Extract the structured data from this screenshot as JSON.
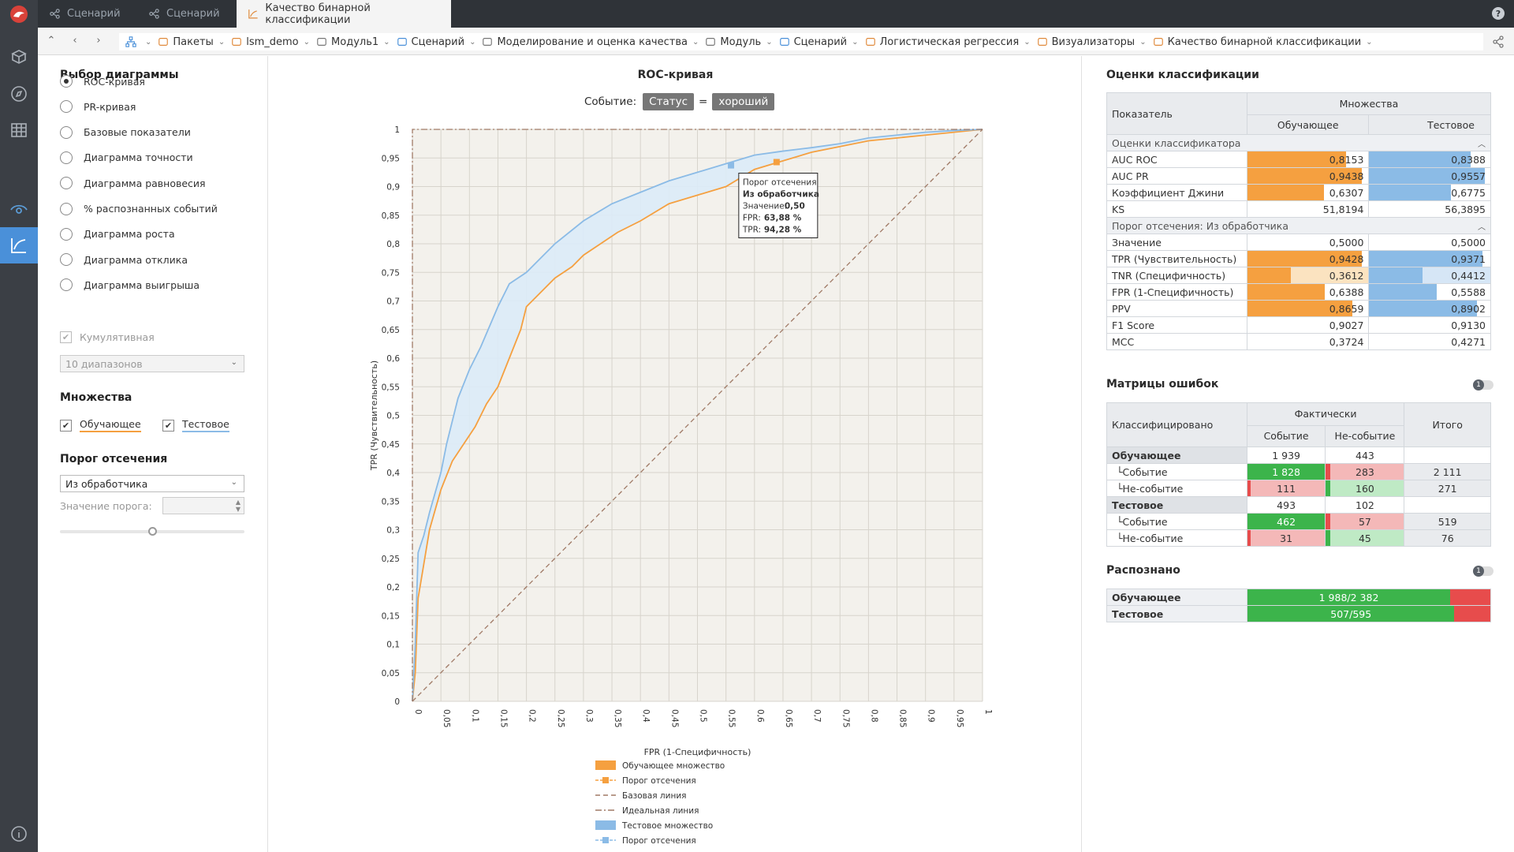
{
  "tabs": [
    {
      "label": "Сценарий"
    },
    {
      "label": "Сценарий"
    },
    {
      "label": "Качество бинарной классификации"
    }
  ],
  "breadcrumbs": [
    {
      "label": "Пакеты"
    },
    {
      "label": "lsm_demo"
    },
    {
      "label": "Модуль1"
    },
    {
      "label": "Сценарий"
    },
    {
      "label": "Моделирование и оценка качества"
    },
    {
      "label": "Модуль"
    },
    {
      "label": "Сценарий"
    },
    {
      "label": "Логистическая регрессия"
    },
    {
      "label": "Визуализаторы"
    },
    {
      "label": "Качество бинарной классификации"
    }
  ],
  "left": {
    "chart_select_title": "Выбор диаграммы",
    "options": [
      "ROC-кривая",
      "PR-кривая",
      "Базовые показатели",
      "Диаграмма точности",
      "Диаграмма равновесия",
      "% распознанных событий",
      "Диаграмма роста",
      "Диаграмма отклика",
      "Диаграмма выигрыша"
    ],
    "selected_option": 0,
    "cumulative_label": "Кумулятивная",
    "ranges_value": "10 диапазонов",
    "sets_title": "Множества",
    "set_train": "Обучающее",
    "set_test": "Тестовое",
    "threshold_title": "Порог отсечения",
    "threshold_mode": "Из обработчика",
    "threshold_value_label": "Значение порога:"
  },
  "chart": {
    "title": "ROC-кривая",
    "event_label": "Событие:",
    "event_field": "Статус",
    "event_eq": "=",
    "event_value": "хороший",
    "xlabel": "FPR (1-Специфичность)",
    "ylabel": "TPR (Чувствительность)",
    "tooltip": {
      "title": "Порог отсечения",
      "source": "Из обработчика",
      "value_label": "Значение:",
      "value": "0,50",
      "fpr_label": "FPR:",
      "fpr": "63,88 %",
      "tpr_label": "TPR:",
      "tpr": "94,28 %"
    },
    "legend": [
      "Обучающее множество",
      "Порог отсечения",
      "Базовая линия",
      "Идеальная линия",
      "Тестовое множество",
      "Порог отсечения"
    ],
    "colors": {
      "train": "#f5a040",
      "test": "#8bbbe6",
      "base": "#a07a66",
      "ideal": "#a07a66"
    }
  },
  "chart_data": {
    "type": "line",
    "xlabel": "FPR (1-Специфичность)",
    "ylabel": "TPR (Чувствительность)",
    "xlim": [
      0,
      1
    ],
    "ylim": [
      0,
      1
    ],
    "ticks": [
      "0",
      "0,05",
      "0,1",
      "0,15",
      "0,2",
      "0,25",
      "0,3",
      "0,35",
      "0,4",
      "0,45",
      "0,5",
      "0,55",
      "0,6",
      "0,65",
      "0,7",
      "0,75",
      "0,8",
      "0,85",
      "0,9",
      "0,95",
      "1"
    ],
    "series": [
      {
        "name": "Обучающее множество",
        "x": [
          0,
          0.005,
          0.01,
          0.02,
          0.03,
          0.05,
          0.07,
          0.09,
          0.11,
          0.13,
          0.15,
          0.17,
          0.19,
          0.2,
          0.22,
          0.25,
          0.28,
          0.3,
          0.33,
          0.36,
          0.4,
          0.45,
          0.5,
          0.55,
          0.6,
          0.65,
          0.7,
          0.75,
          0.8,
          0.85,
          0.9,
          0.95,
          1
        ],
        "y": [
          0,
          0.05,
          0.18,
          0.24,
          0.3,
          0.37,
          0.42,
          0.45,
          0.48,
          0.52,
          0.55,
          0.6,
          0.65,
          0.69,
          0.71,
          0.74,
          0.76,
          0.78,
          0.8,
          0.82,
          0.84,
          0.87,
          0.885,
          0.9,
          0.93,
          0.945,
          0.96,
          0.97,
          0.98,
          0.985,
          0.99,
          0.995,
          1
        ]
      },
      {
        "name": "Тестовое множество",
        "x": [
          0,
          0.005,
          0.01,
          0.02,
          0.03,
          0.05,
          0.06,
          0.08,
          0.1,
          0.12,
          0.15,
          0.17,
          0.2,
          0.22,
          0.25,
          0.3,
          0.35,
          0.4,
          0.45,
          0.5,
          0.55,
          0.6,
          0.65,
          0.7,
          0.75,
          0.8,
          0.85,
          0.9,
          0.95,
          1
        ],
        "y": [
          0,
          0.1,
          0.26,
          0.29,
          0.33,
          0.4,
          0.45,
          0.53,
          0.58,
          0.62,
          0.69,
          0.73,
          0.75,
          0.77,
          0.8,
          0.84,
          0.87,
          0.89,
          0.91,
          0.925,
          0.94,
          0.955,
          0.962,
          0.968,
          0.975,
          0.985,
          0.99,
          0.995,
          0.998,
          1
        ]
      },
      {
        "name": "Базовая линия",
        "x": [
          0,
          1
        ],
        "y": [
          0,
          1
        ]
      },
      {
        "name": "Идеальная линия",
        "x": [
          0,
          0,
          1
        ],
        "y": [
          0,
          1,
          1
        ]
      }
    ],
    "thresholds": [
      {
        "name": "Порог отсечения",
        "x": 0.6388,
        "y": 0.9428
      },
      {
        "name": "Порог отсечения",
        "x": 0.5588,
        "y": 0.9371
      }
    ]
  },
  "right": {
    "metrics_title": "Оценки классификации",
    "col_indicator": "Показатель",
    "col_sets": "Множества",
    "col_train": "Обучающее",
    "col_test": "Тестовое",
    "group1": "Оценки классификатора",
    "group1_rows": [
      {
        "name": "AUC ROC",
        "train": "0,8153",
        "test": "0,8388",
        "tf": 0.8153,
        "sf": 0.8388
      },
      {
        "name": "AUC PR",
        "train": "0,9438",
        "test": "0,9557",
        "tf": 0.9438,
        "sf": 0.9557
      },
      {
        "name": "Коэффициент Джини",
        "train": "0,6307",
        "test": "0,6775",
        "tf": 0.6307,
        "sf": 0.6775
      },
      {
        "name": "KS",
        "train": "51,8194",
        "test": "56,3895"
      }
    ],
    "group2": "Порог отсечения: Из обработчика",
    "group2_rows": [
      {
        "name": "Значение",
        "train": "0,5000",
        "test": "0,5000"
      },
      {
        "name": "TPR (Чувствительность)",
        "train": "0,9428",
        "test": "0,9371",
        "tf": 0.9428,
        "sf": 0.9371
      },
      {
        "name": "TNR (Специфичность)",
        "train": "0,3612",
        "test": "0,4412",
        "tf": 0.3612,
        "sf": 0.4412
      },
      {
        "name": "FPR (1-Специфичность)",
        "train": "0,6388",
        "test": "0,5588",
        "tf": 0.6388,
        "sf": 0.5588
      },
      {
        "name": "PPV",
        "train": "0,8659",
        "test": "0,8902",
        "tf": 0.8659,
        "sf": 0.8902
      },
      {
        "name": "F1 Score",
        "train": "0,9027",
        "test": "0,9130"
      },
      {
        "name": "MCC",
        "train": "0,3724",
        "test": "0,4271"
      }
    ],
    "confusion_title": "Матрицы ошибок",
    "confusion_toggle": "1",
    "cm_classified": "Классифицировано",
    "cm_actual": "Фактически",
    "cm_event": "Событие",
    "cm_nonevent": "Не-событие",
    "cm_total": "Итого",
    "cm": [
      {
        "name": "Обучающее",
        "ev": "1 939",
        "ne": "443",
        "tot": "",
        "group": true
      },
      {
        "name": "Событие",
        "ev": "1 828",
        "ne": "283",
        "tot": "2 111"
      },
      {
        "name": "Не-событие",
        "ev": "111",
        "ne": "160",
        "tot": "271"
      },
      {
        "name": "Тестовое",
        "ev": "493",
        "ne": "102",
        "tot": "",
        "group": true
      },
      {
        "name": "Событие",
        "ev": "462",
        "ne": "57",
        "tot": "519"
      },
      {
        "name": "Не-событие",
        "ev": "31",
        "ne": "45",
        "tot": "76"
      }
    ],
    "recog_title": "Распознано",
    "recog_toggle": "1",
    "recog": [
      {
        "name": "Обучающее",
        "value": "1 988/2 382",
        "frac": 0.8346
      },
      {
        "name": "Тестовое",
        "value": "507/595",
        "frac": 0.8521
      }
    ]
  }
}
